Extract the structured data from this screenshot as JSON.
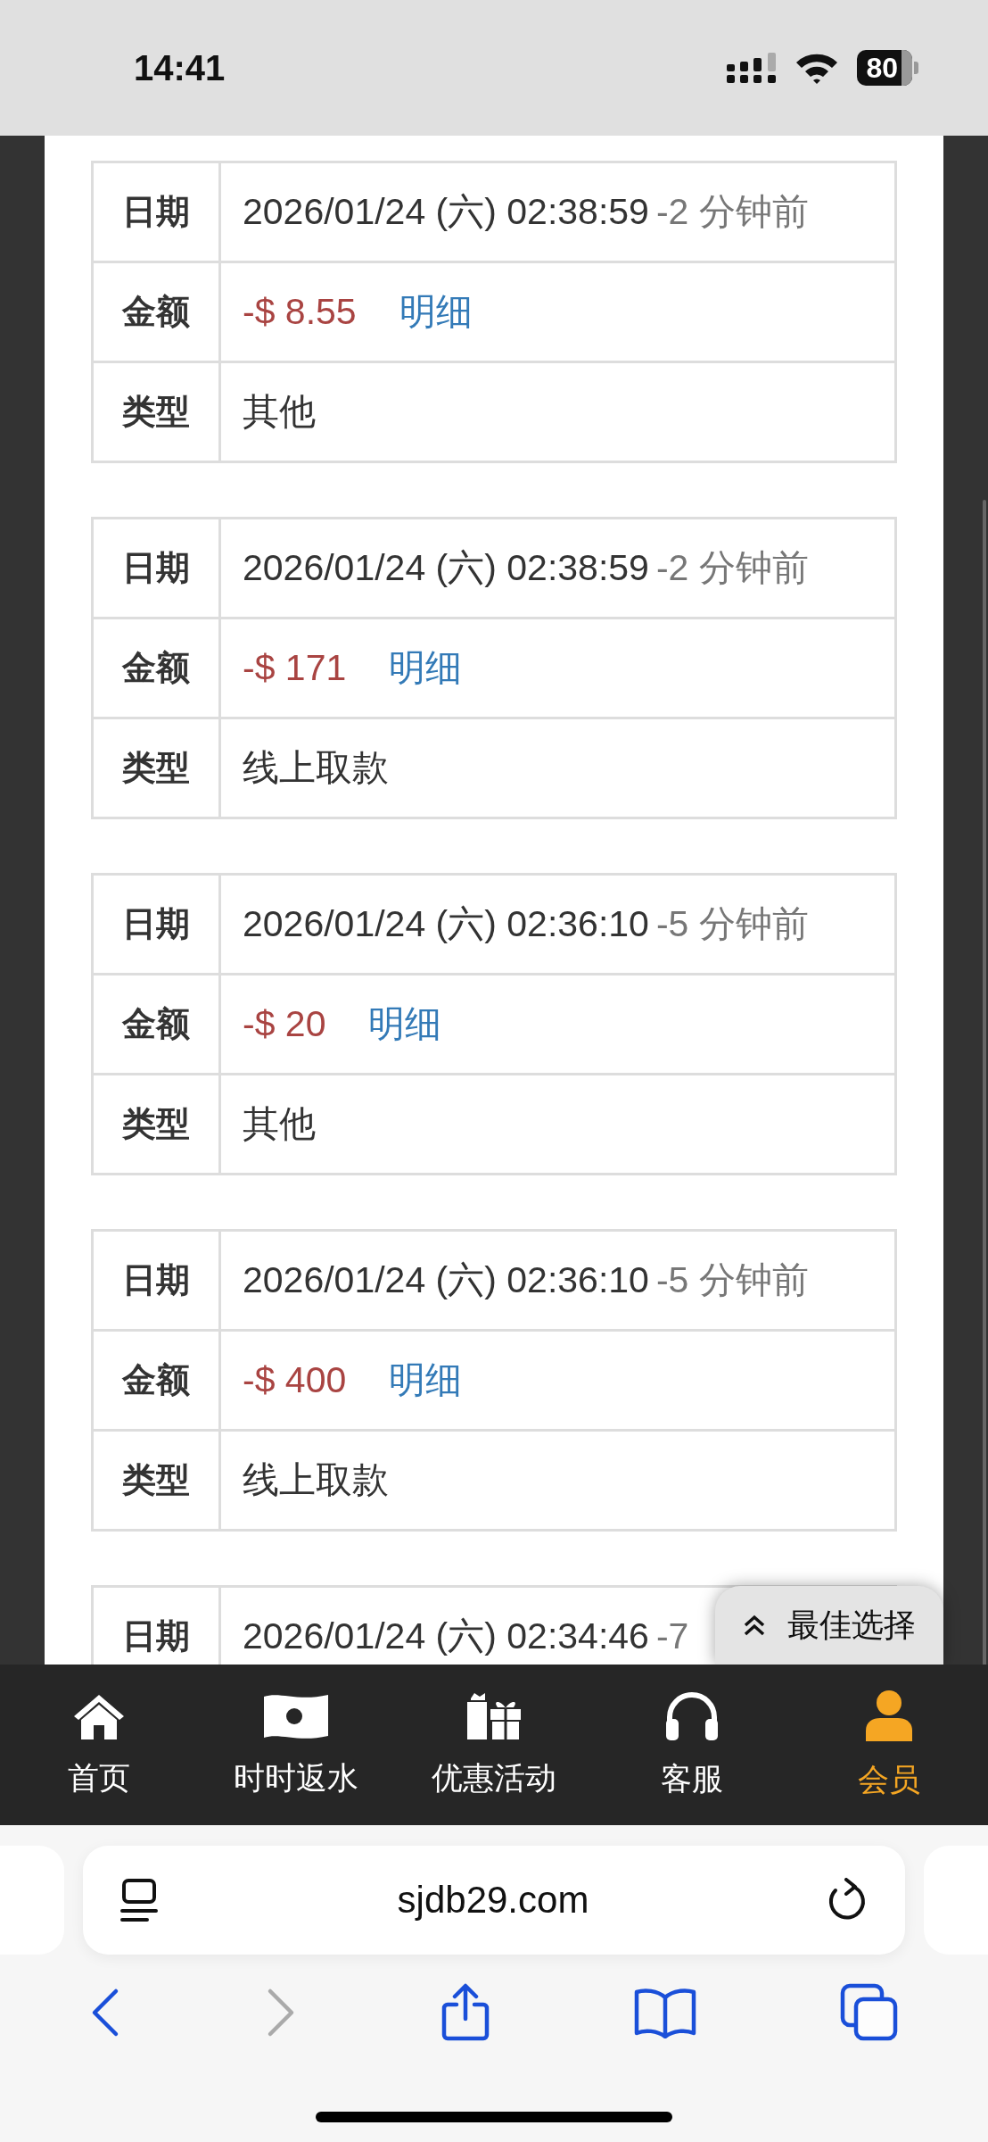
{
  "status_bar": {
    "time": "14:41",
    "battery": "80"
  },
  "records": [
    {
      "rows": [
        {
          "kind": "date",
          "label": "日期",
          "value": "2026/01/24 (六) 02:38:59",
          "ago": "-2 分钟前"
        },
        {
          "kind": "amount",
          "label": "金额",
          "value": "-$ 8.55",
          "link": "明细"
        },
        {
          "kind": "text",
          "label": "类型",
          "value": "其他"
        }
      ]
    },
    {
      "rows": [
        {
          "kind": "date",
          "label": "日期",
          "value": "2026/01/24 (六) 02:38:59",
          "ago": "-2 分钟前"
        },
        {
          "kind": "amount",
          "label": "金额",
          "value": "-$ 171",
          "link": "明细"
        },
        {
          "kind": "text",
          "label": "类型",
          "value": "线上取款"
        }
      ]
    },
    {
      "rows": [
        {
          "kind": "date",
          "label": "日期",
          "value": "2026/01/24 (六) 02:36:10",
          "ago": "-5 分钟前"
        },
        {
          "kind": "amount",
          "label": "金额",
          "value": "-$ 20",
          "link": "明细"
        },
        {
          "kind": "text",
          "label": "类型",
          "value": "其他"
        }
      ]
    },
    {
      "rows": [
        {
          "kind": "date",
          "label": "日期",
          "value": "2026/01/24 (六) 02:36:10",
          "ago": "-5 分钟前"
        },
        {
          "kind": "amount",
          "label": "金额",
          "value": "-$ 400",
          "link": "明细"
        },
        {
          "kind": "text",
          "label": "类型",
          "value": "线上取款"
        }
      ]
    },
    {
      "rows": [
        {
          "kind": "date",
          "label": "日期",
          "value": "2026/01/24 (六) 02:34:46",
          "ago": "-7"
        }
      ]
    }
  ],
  "float_button": {
    "label": "最佳选择"
  },
  "bottom_nav": [
    {
      "kind": "home",
      "label": "首页",
      "selected": false
    },
    {
      "kind": "rebate",
      "label": "时时返水",
      "selected": false
    },
    {
      "kind": "gift",
      "label": "优惠活动",
      "selected": false
    },
    {
      "kind": "support",
      "label": "客服",
      "selected": false
    },
    {
      "kind": "member",
      "label": "会员",
      "selected": true
    }
  ],
  "browser": {
    "url": "sjdb29.com"
  }
}
